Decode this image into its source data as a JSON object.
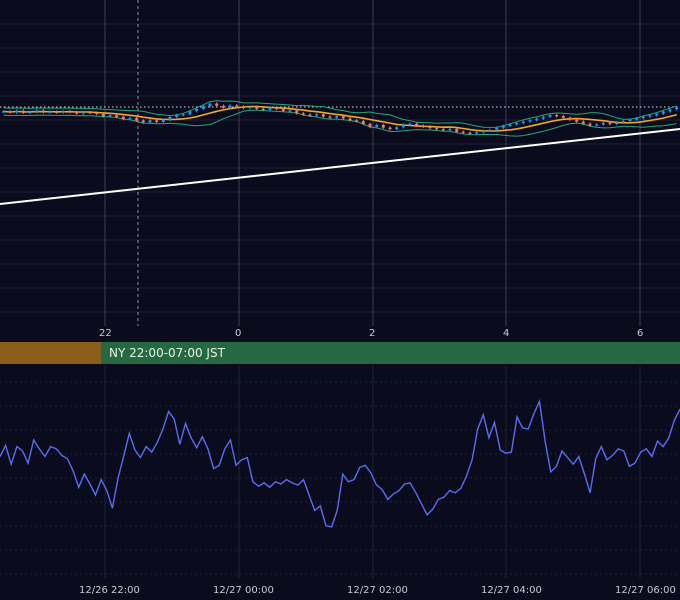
{
  "theme": {
    "background": "#0b0b1e",
    "grid_vertical": "#3a3d55",
    "grid_horizontal": "#1f2236",
    "candle_up": "#2196f3",
    "candle_down": "#ef7a6b",
    "moving_average": "#f5a623",
    "bollinger": "#27a77a",
    "trend_line": "#ffffff",
    "reference_line": "#d8d8d8",
    "oscillator_line": "#5b6cf0",
    "session_asia": "#8a5d1b",
    "session_ny": "#256842"
  },
  "session": {
    "label": "NY 22:00-07:00 JST"
  },
  "time_axis_top": {
    "ticks": [
      "22",
      "0",
      "2",
      "4",
      "6"
    ]
  },
  "time_axis_bottom": {
    "ticks": [
      "12/26 22:00",
      "12/27 00:00",
      "12/27 02:00",
      "12/27 04:00",
      "12/27 06:00"
    ]
  },
  "chart_data": [
    {
      "type": "candlestick",
      "series": [
        {
          "name": "",
          "kind": "candles",
          "close": [
            0.6,
            0.2,
            0.9,
            0.1,
            0.4,
            1.0,
            0.3,
            0.5,
            0.2,
            0.7,
            0.4,
            -0.2,
            0.3,
            0.1,
            -0.4,
            -1.3,
            -0.8,
            -1.5,
            -2.3,
            -1.9,
            -2.9,
            -3.6,
            -2.8,
            -3.4,
            -2.6,
            -1.5,
            -0.8,
            -0.5,
            0.7,
            1.6,
            2.6,
            3.6,
            2.8,
            2.1,
            2.9,
            2.5,
            1.9,
            2.4,
            1.6,
            1.2,
            2.1,
            1.5,
            0.8,
            1.0,
            -0.1,
            -0.6,
            -1.0,
            -0.5,
            -1.4,
            -1.8,
            -1.2,
            -2.1,
            -2.8,
            -3.1,
            -4.2,
            -5.3,
            -4.6,
            -5.6,
            -6.2,
            -5.5,
            -4.4,
            -4.1,
            -4.9,
            -5.3,
            -5.8,
            -6.2,
            -6.6,
            -6.1,
            -7.2,
            -7.6,
            -7.9,
            -7.4,
            -6.8,
            -6.5,
            -5.7,
            -5.0,
            -4.4,
            -3.9,
            -3.3,
            -2.8,
            -2.2,
            -1.5,
            -0.8,
            -1.2,
            -1.8,
            -2.6,
            -3.3,
            -4.1,
            -4.8,
            -4.4,
            -3.8,
            -4.2,
            -3.6,
            -3.1,
            -2.6,
            -2.0,
            -1.4,
            -0.9,
            -0.3,
            0.6,
            1.4,
            2.1
          ]
        },
        {
          "name": "",
          "kind": "moving_average"
        },
        {
          "name": "",
          "kind": "bollinger_band"
        },
        {
          "name": "",
          "kind": "trend_line"
        },
        {
          "name": "",
          "kind": "horizontal_reference"
        }
      ]
    },
    {
      "type": "line",
      "series": [
        {
          "name": "",
          "values": [
            0.5,
            1.5,
            -0.2,
            1.4,
            1.0,
            -0.1,
            2.0,
            1.2,
            0.5,
            1.4,
            1.2,
            0.6,
            0.3,
            -0.8,
            -2.3,
            -1.1,
            -2.0,
            -3.0,
            -1.6,
            -2.6,
            -4.2,
            -1.5,
            0.5,
            2.6,
            1.1,
            0.4,
            1.4,
            0.9,
            1.8,
            3.0,
            4.6,
            3.9,
            1.6,
            3.5,
            2.2,
            1.3,
            2.3,
            1.2,
            -0.6,
            -0.3,
            1.2,
            2.0,
            -0.3,
            0.2,
            0.4,
            -1.8,
            -2.2,
            -1.9,
            -2.3,
            -1.8,
            -2.0,
            -1.6,
            -1.9,
            -2.1,
            -1.6,
            -3.0,
            -4.4,
            -4.0,
            -5.8,
            -5.9,
            -4.4,
            -1.1,
            -1.8,
            -1.6,
            -0.5,
            -0.3,
            -1.0,
            -2.1,
            -2.5,
            -3.4,
            -2.9,
            -2.6,
            -2.0,
            -1.9,
            -2.8,
            -3.8,
            -4.8,
            -4.3,
            -3.4,
            -3.2,
            -2.6,
            -2.8,
            -2.4,
            -1.3,
            0.2,
            3.0,
            4.3,
            2.2,
            3.6,
            1.1,
            0.8,
            0.9,
            4.1,
            3.1,
            3.0,
            4.4,
            5.5,
            1.9,
            -0.9,
            -0.4,
            1.0,
            0.4,
            -0.2,
            0.5,
            -1.1,
            -2.8,
            0.3,
            1.4,
            0.2,
            0.6,
            1.2,
            1.0,
            -0.4,
            -0.1,
            0.9,
            1.2,
            0.5,
            1.9,
            1.4,
            2.2,
            3.8,
            4.8
          ]
        }
      ]
    }
  ]
}
